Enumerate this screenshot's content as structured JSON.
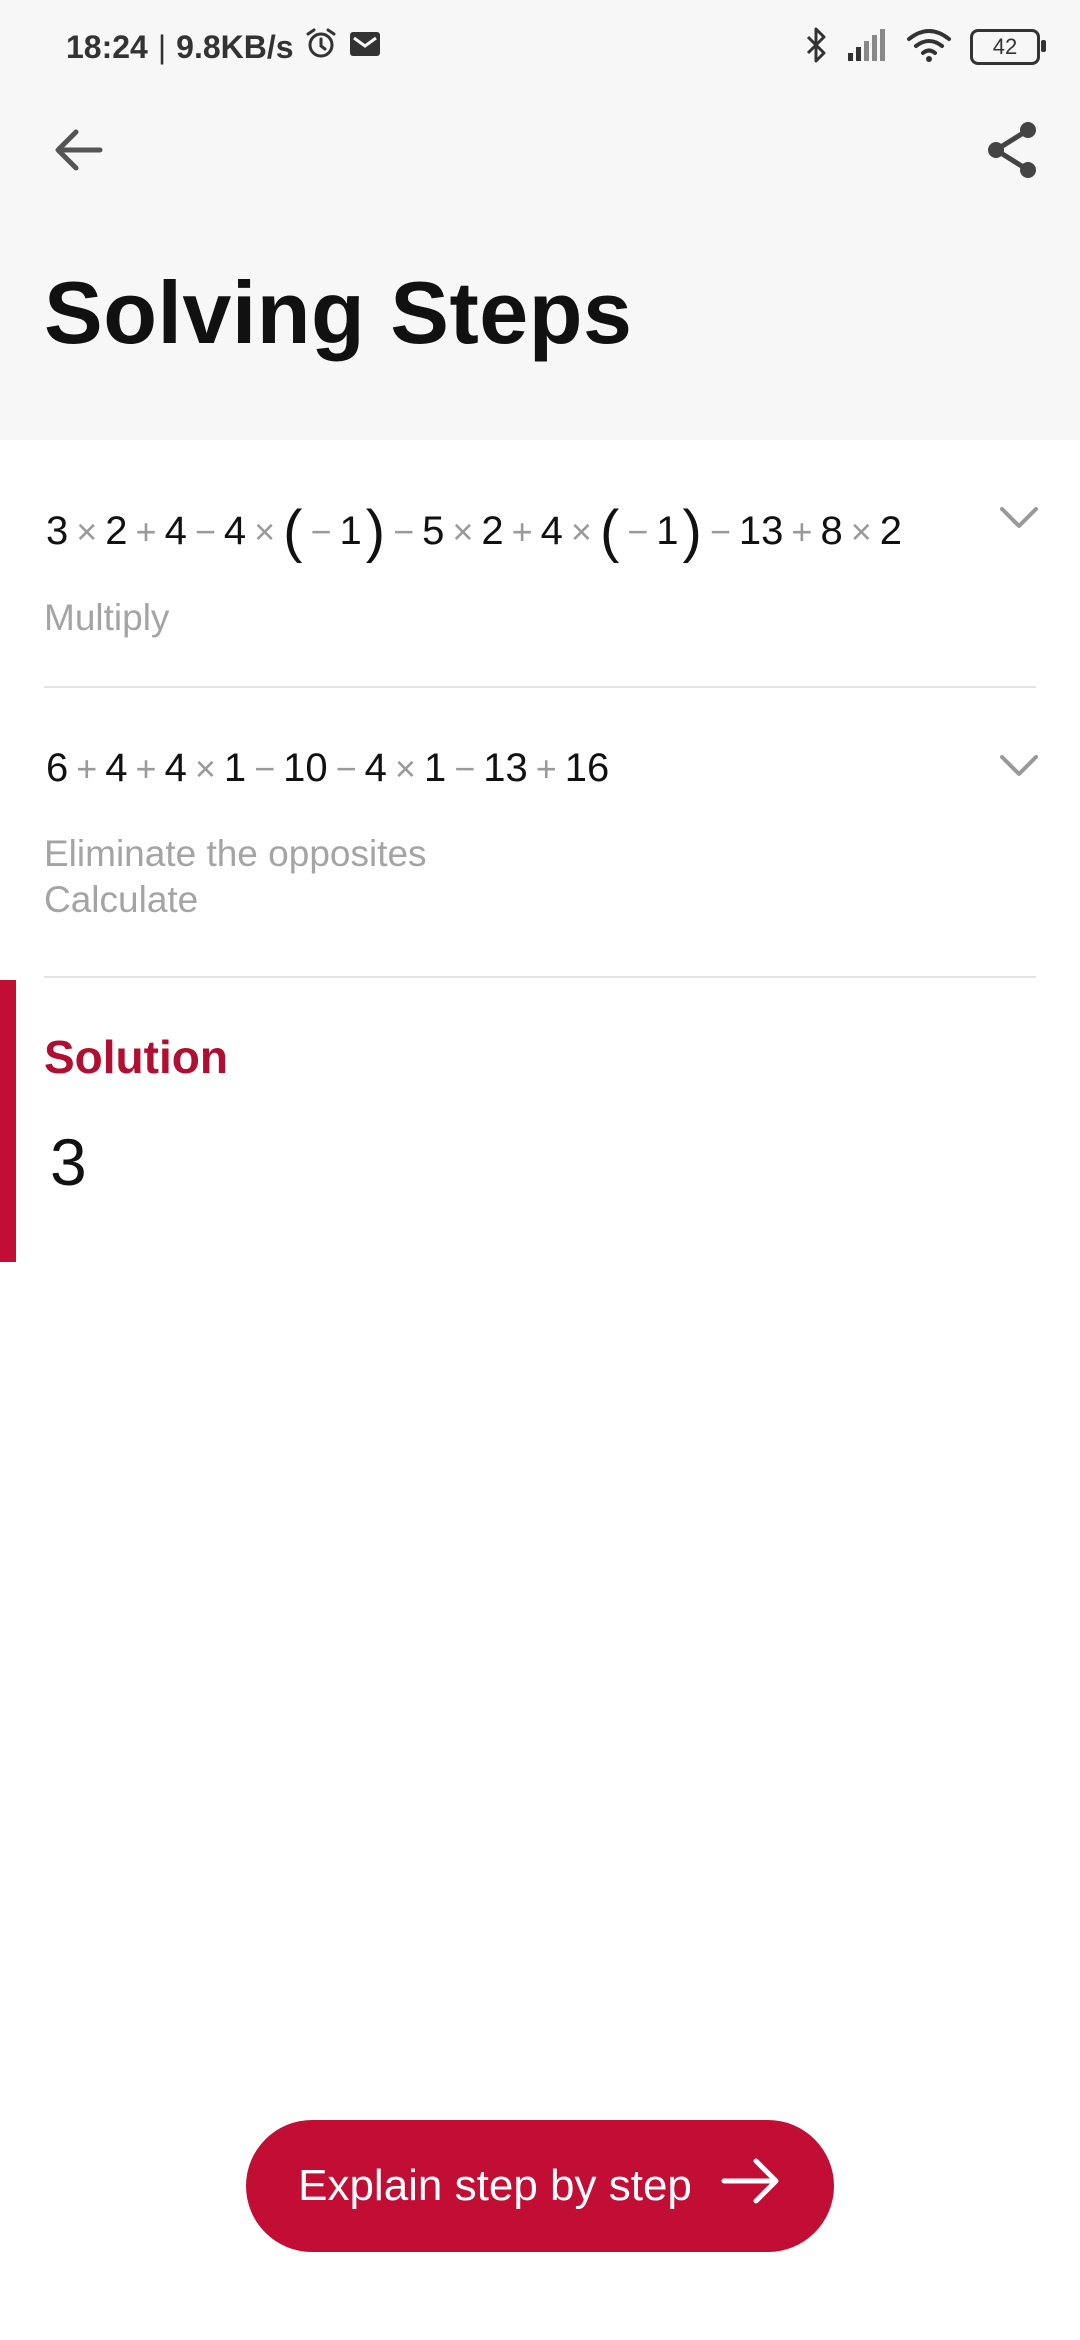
{
  "status_bar": {
    "time": "18:24",
    "separator": "|",
    "speed": "9.8KB/s",
    "battery": "42"
  },
  "header": {
    "title": "Solving Steps"
  },
  "steps": [
    {
      "expression_tokens": [
        "3",
        "×",
        "2",
        "+",
        "4",
        "−",
        "4",
        "×",
        "(",
        "−",
        "1",
        ")",
        "−",
        "5",
        "×",
        "2",
        "+",
        "4",
        "×",
        "(",
        "−",
        "1",
        ")",
        "−",
        "13",
        "+",
        "8",
        "×",
        "2"
      ],
      "description": [
        "Multiply"
      ]
    },
    {
      "expression_tokens": [
        "6",
        "+",
        "4",
        "+",
        "4",
        "×",
        "1",
        "−",
        "10",
        "−",
        "4",
        "×",
        "1",
        "−",
        "13",
        "+",
        "16"
      ],
      "description": [
        "Eliminate the opposites",
        "Calculate"
      ]
    }
  ],
  "solution": {
    "label": "Solution",
    "value": "3"
  },
  "explain_button": {
    "label": "Explain step by step"
  },
  "colors": {
    "accent": "#c20e34",
    "header_bg": "#f7f7f7",
    "muted_text": "#a4a4a4"
  }
}
